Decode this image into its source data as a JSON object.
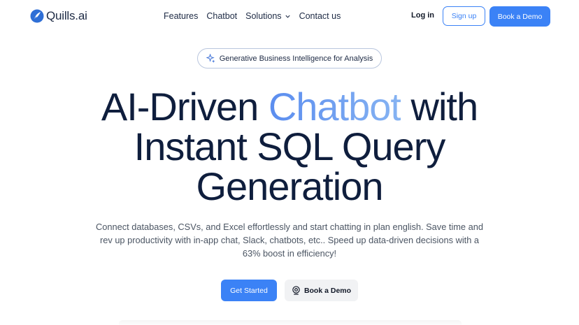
{
  "nav": {
    "logo_text": "Quills.ai",
    "links": [
      {
        "label": "Features"
      },
      {
        "label": "Chatbot"
      },
      {
        "label": "Solutions"
      },
      {
        "label": "Contact us"
      }
    ],
    "login_label": "Log in",
    "signup_label": "Sign up",
    "demo_label": "Book a Demo"
  },
  "badge": {
    "text": "Generative Business Intelligence for Analysis",
    "icon": "sparkle-icon"
  },
  "hero": {
    "title_part1": "AI-Driven ",
    "title_accent": "Chatbot",
    "title_part2": " with",
    "title_line2": "Instant SQL Query",
    "title_line3": "Generation",
    "subtitle": "Connect databases, CSVs, and Excel effortlessly and start chatting in plan english. Save time and rev up productivity with in-app chat, Slack, chatbots, etc.. Speed up data-driven decisions with a 63% boost in efficiency!",
    "cta_primary": "Get Started",
    "cta_secondary": "Book a Demo",
    "cta_secondary_icon": "webcam-icon"
  },
  "colors": {
    "accent": "#3b82f6",
    "heading": "#0f1e3d",
    "gradient_start": "#5b8def",
    "gradient_end": "#86b3f2"
  }
}
